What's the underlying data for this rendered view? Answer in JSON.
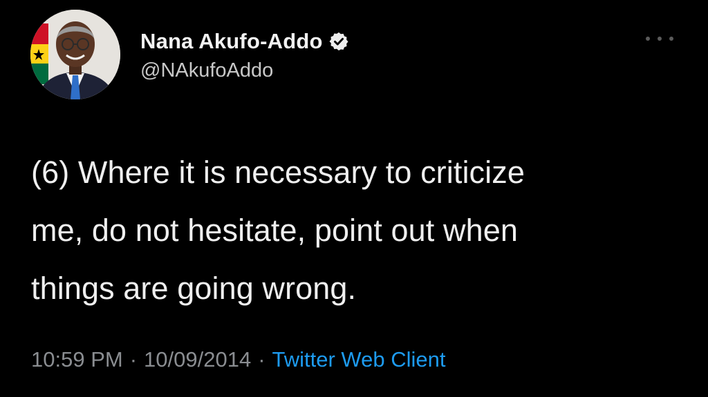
{
  "tweet": {
    "author": {
      "display_name": "Nana Akufo-Addo",
      "handle": "@NAkufoAddo",
      "verified": true
    },
    "text_lines": [
      "(6) Where it is necessary to criticize",
      "me, do not hesitate, point out when",
      "things are going wrong."
    ],
    "time": "10:59 PM",
    "date": "10/09/2014",
    "separator": "·",
    "client": "Twitter Web Client"
  },
  "icons": {
    "verified": "verified-badge-icon",
    "more": "more-options-icon"
  },
  "colors": {
    "background": "#000000",
    "primary_text": "#efefef",
    "secondary_text": "#8a8d91",
    "link": "#1d9bf0"
  }
}
